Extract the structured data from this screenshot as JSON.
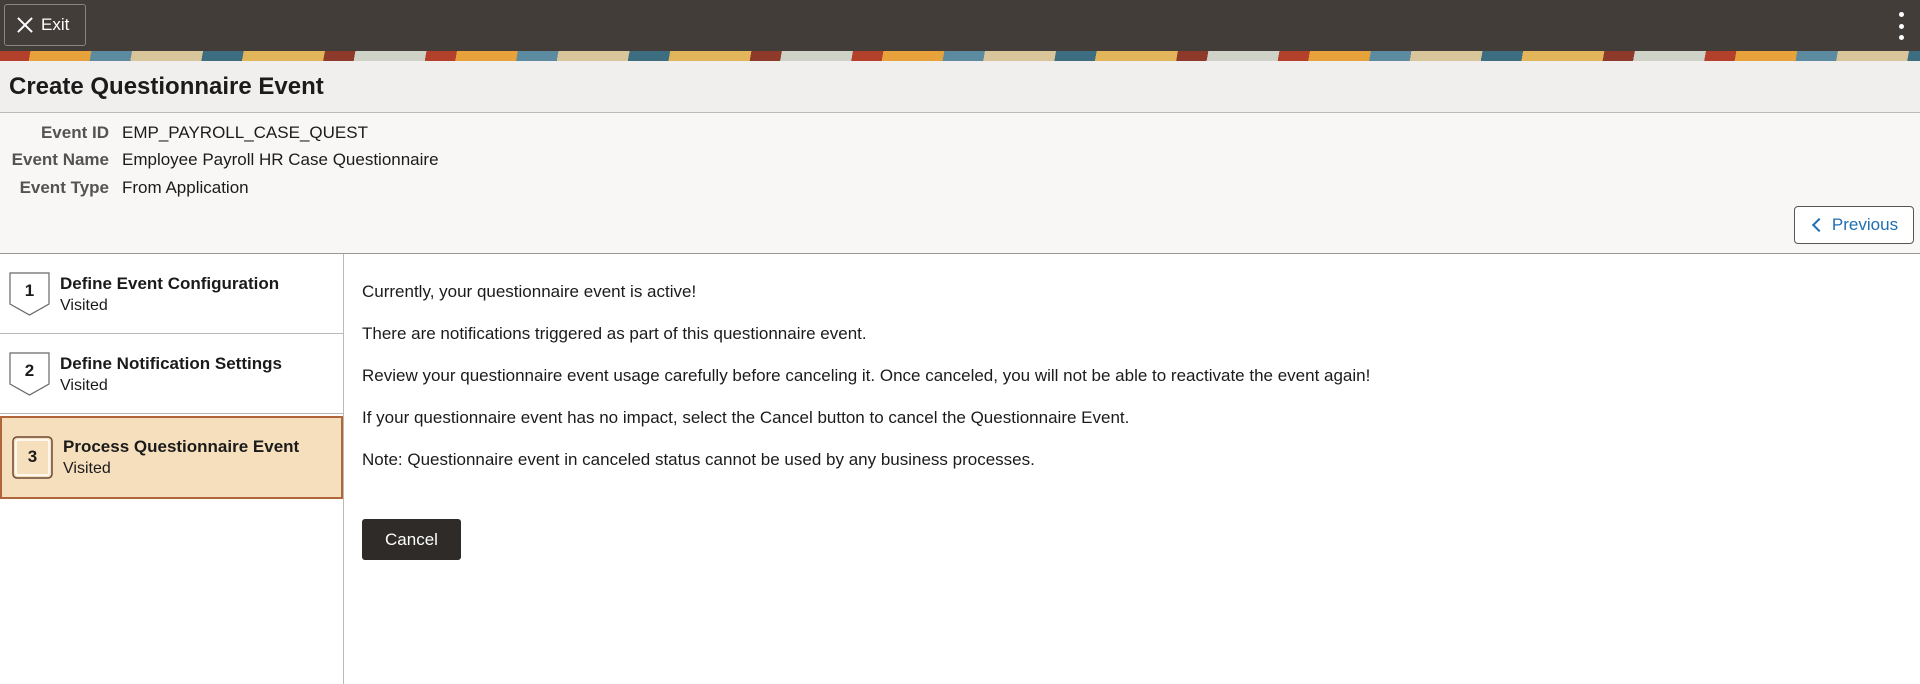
{
  "topbar": {
    "exit_label": "Exit",
    "exit_icon": "close-icon",
    "menu_icon": "kebab-menu-icon"
  },
  "page": {
    "title": "Create Questionnaire Event"
  },
  "event_info": {
    "fields": [
      {
        "label": "Event ID",
        "value": "EMP_PAYROLL_CASE_QUEST"
      },
      {
        "label": "Event Name",
        "value": "Employee Payroll HR Case Questionnaire"
      },
      {
        "label": "Event Type",
        "value": "From Application"
      }
    ],
    "previous_label": "Previous"
  },
  "steps": [
    {
      "number": "1",
      "title": "Define Event Configuration",
      "status": "Visited",
      "active": false
    },
    {
      "number": "2",
      "title": "Define Notification Settings",
      "status": "Visited",
      "active": false
    },
    {
      "number": "3",
      "title": "Process Questionnaire Event",
      "status": "Visited",
      "active": true
    }
  ],
  "main": {
    "messages": [
      "Currently, your questionnaire event is active!",
      "There are notifications triggered as part of this questionnaire event.",
      "Review your questionnaire event usage carefully before canceling it. Once canceled, you will not be able to reactivate the event again!",
      "If your questionnaire event has no impact, select the Cancel button to cancel the Questionnaire Event.",
      "Note: Questionnaire event in canceled status cannot be used by any business processes."
    ],
    "cancel_label": "Cancel"
  },
  "colors": {
    "topbar": "#423d39",
    "active_step_bg": "#f6dfbd",
    "active_step_border": "#b0653b",
    "link": "#1f6fb2",
    "primary_button": "#2e2b28"
  }
}
